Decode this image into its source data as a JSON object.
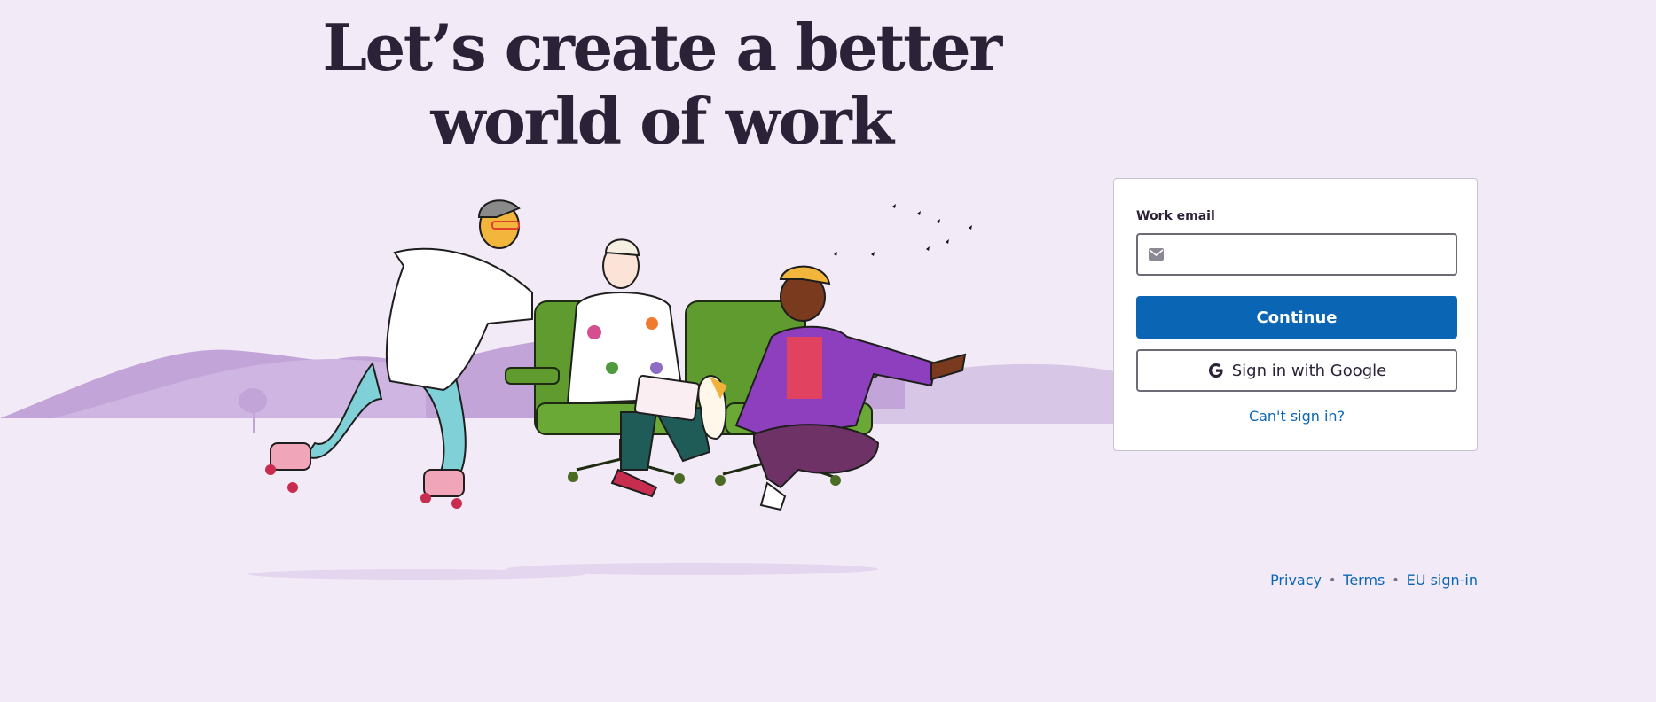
{
  "headline": {
    "line1": "Let’s create a better",
    "line2": "world of work"
  },
  "login": {
    "email_label": "Work email",
    "email_value": "",
    "email_placeholder": "",
    "continue_label": "Continue",
    "google_label": "Sign in with Google",
    "cant_sign_in": "Can't sign in?"
  },
  "footer": {
    "links": [
      "Privacy",
      "Terms",
      "EU sign-in"
    ],
    "separator": "•"
  },
  "colors": {
    "background": "#f2eaf6",
    "primary": "#0a66b5",
    "text": "#2b2238",
    "hills_dark": "#c2a4d9",
    "hills_light": "#d8c6e6",
    "chair_green": "#5f9b2f"
  },
  "icons": {
    "email": "mail-icon",
    "google": "google-g-icon"
  }
}
